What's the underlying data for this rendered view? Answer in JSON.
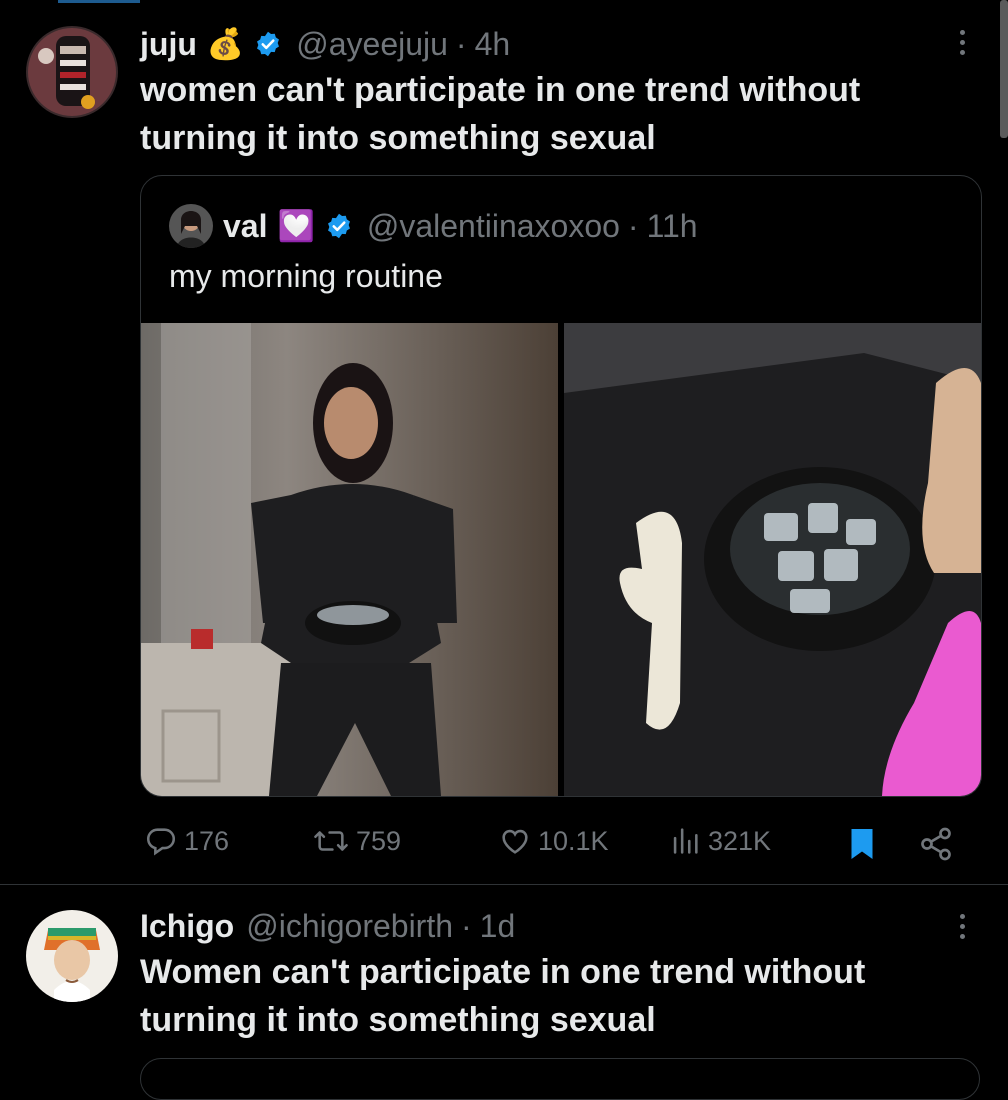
{
  "tweets": [
    {
      "name": "juju",
      "emoji": "💰",
      "handle": "@ayeejuju",
      "separator": "·",
      "time": "4h",
      "text": "women can't participate in one trend without turning it into something sexual",
      "quoted": {
        "name": "val",
        "emoji": "💟",
        "handle": "@valentiinaxoxoo",
        "separator": "·",
        "time": "11h",
        "text": "my morning routine"
      },
      "stats": {
        "replies": "176",
        "reposts": "759",
        "likes": "10.1K",
        "views": "321K"
      },
      "bookmarked": true
    },
    {
      "name": "Ichigo",
      "handle": "@ichigorebirth",
      "separator": "·",
      "time": "1d",
      "text": "Women can't participate in one trend without turning it into something sexual"
    }
  ],
  "colors": {
    "background": "#000000",
    "text": "#e7e9ea",
    "muted": "#71767b",
    "verified": "#1d9bf0",
    "bookmark": "#1d9bf0",
    "border": "#2f3336"
  },
  "icons": [
    "more-icon",
    "verified-badge-icon",
    "reply-icon",
    "repost-icon",
    "like-icon",
    "views-icon",
    "bookmark-icon",
    "share-icon"
  ]
}
